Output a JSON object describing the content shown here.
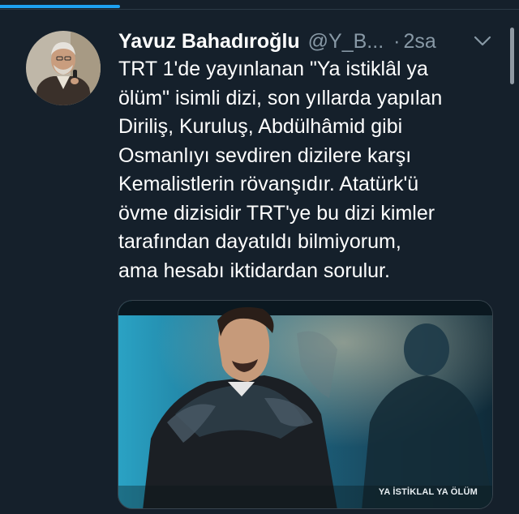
{
  "tweet": {
    "author_name": "Yavuz Bahadıroğlu",
    "handle": "@Y_B...",
    "separator": "·",
    "time": "2sa",
    "text_lines": [
      "TRT 1'de yayınlanan \"Ya istiklâl ya",
      "ölüm\" isimli dizi, son yıllarda yapılan",
      "Diriliş, Kuruluş, Abdülhâmid gibi",
      "Osmanlıyı sevdiren dizilere karşı",
      "Kemalistlerin rövanşıdır. Atatürk'ü",
      "övme dizisidir TRT'ye bu dizi kimler",
      "tarafından dayatıldı bilmiyorum,",
      "ama hesabı iktidardan sorulur."
    ],
    "media_caption": "YA İSTİKLAL YA ÖLÜM"
  },
  "icons": {
    "menu": "chevron-down-icon",
    "avatar": "avatar"
  },
  "colors": {
    "background": "#15202b",
    "accent": "#1da1f2",
    "secondary_text": "#8899a6",
    "primary_text": "#ffffff"
  }
}
